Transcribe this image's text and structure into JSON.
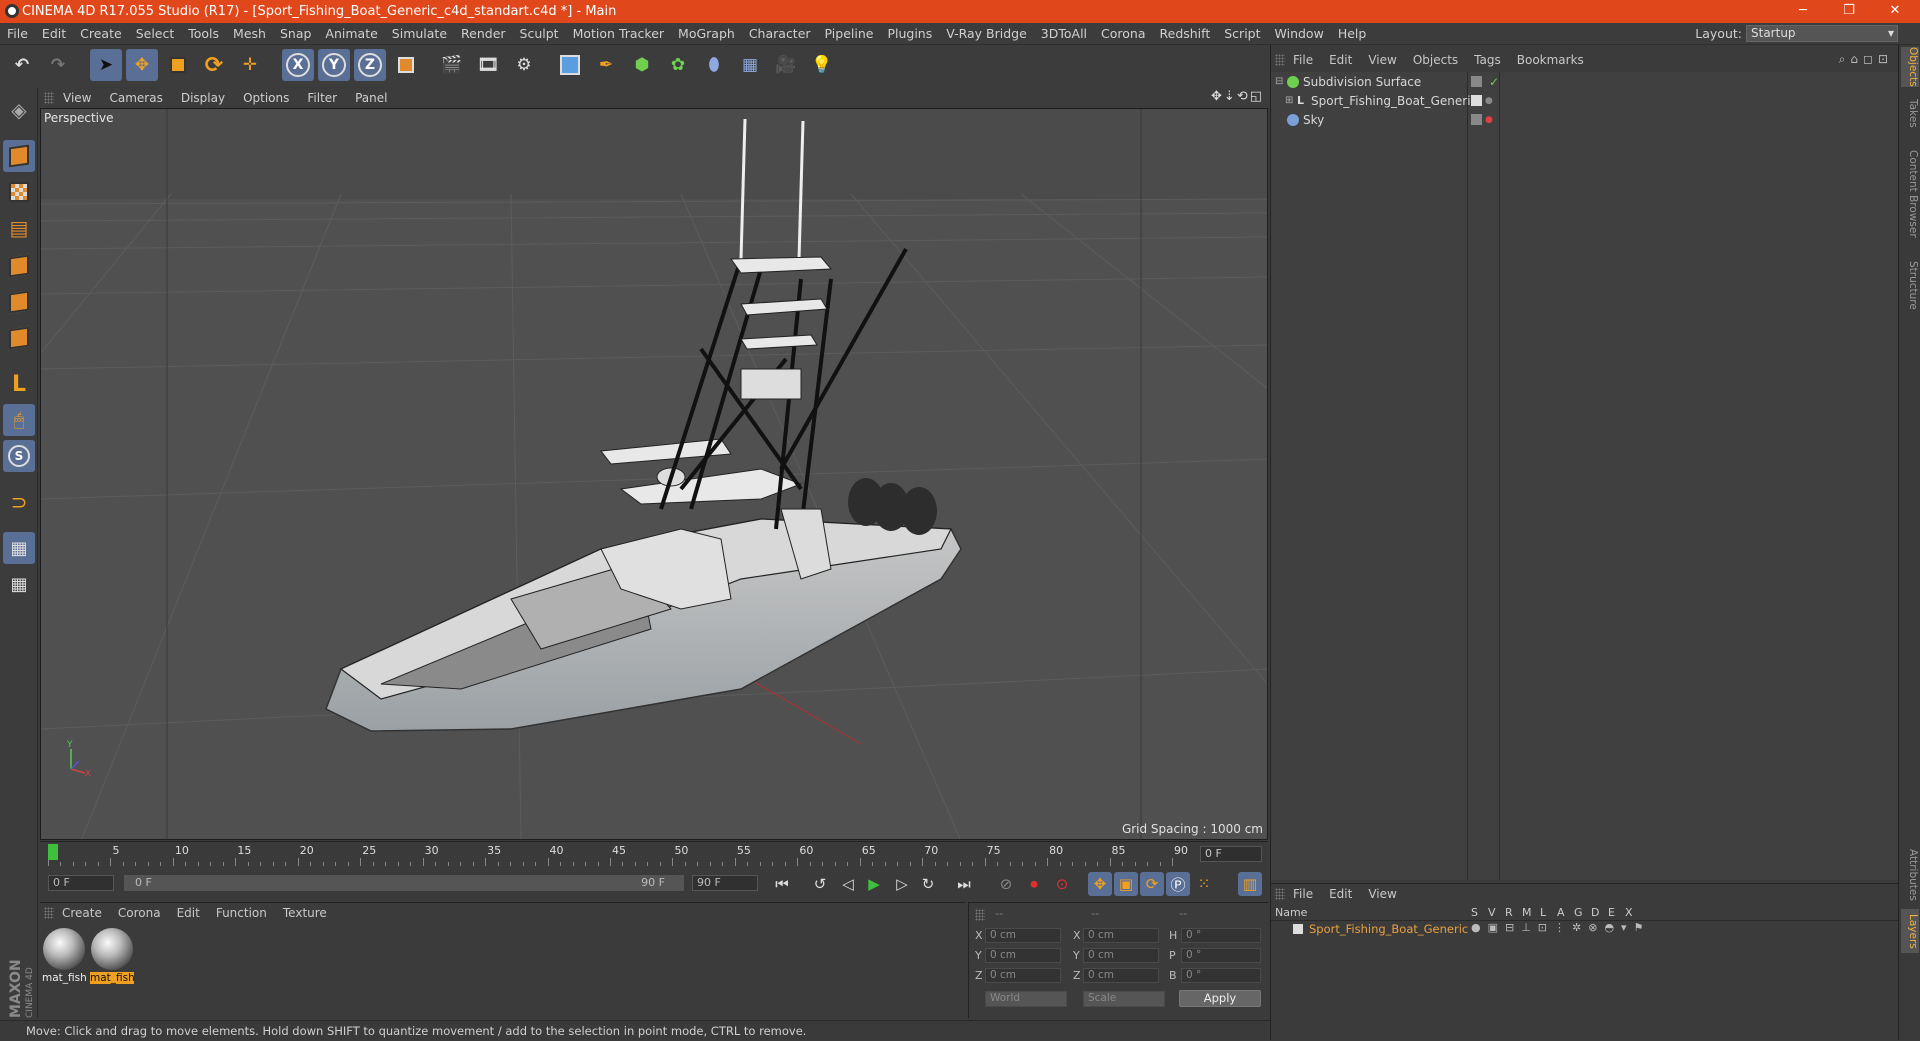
{
  "window": {
    "title": "CINEMA 4D R17.055 Studio (R17) - [Sport_Fishing_Boat_Generic_c4d_standart.c4d *] - Main",
    "minimize": "─",
    "restore": "❐",
    "close": "✕"
  },
  "menubar": {
    "items": [
      "File",
      "Edit",
      "Create",
      "Select",
      "Tools",
      "Mesh",
      "Snap",
      "Animate",
      "Simulate",
      "Render",
      "Sculpt",
      "Motion Tracker",
      "MoGraph",
      "Character",
      "Pipeline",
      "Plugins",
      "V-Ray Bridge",
      "3DToAll",
      "Corona",
      "Redshift",
      "Script",
      "Window",
      "Help"
    ],
    "layout_label": "Layout:",
    "layout_value": "Startup"
  },
  "toolbar": {
    "axis_x": "X",
    "axis_y": "Y",
    "axis_z": "Z"
  },
  "viewport": {
    "menu": [
      "View",
      "Cameras",
      "Display",
      "Options",
      "Filter",
      "Panel"
    ],
    "label": "Perspective",
    "grid_spacing": "Grid Spacing : 1000 cm"
  },
  "timeline": {
    "ticks": [
      "0",
      "5",
      "10",
      "15",
      "20",
      "25",
      "30",
      "35",
      "40",
      "45",
      "50",
      "55",
      "60",
      "65",
      "70",
      "75",
      "80",
      "85",
      "90"
    ],
    "current_frame": "0 F"
  },
  "transport": {
    "start_field": "0 F",
    "range_start": "0 F",
    "range_end": "90 F",
    "end_field": "90 F"
  },
  "materials": {
    "menu": [
      "Create",
      "Corona",
      "Edit",
      "Function",
      "Texture"
    ],
    "items": [
      {
        "label": "mat_fish",
        "selected": false
      },
      {
        "label": "mat_fish",
        "selected": true
      }
    ]
  },
  "coordinates": {
    "header": [
      "--",
      "--",
      "--"
    ],
    "rows": [
      {
        "a": "X",
        "v1": "0 cm",
        "b": "X",
        "v2": "0 cm",
        "c": "H",
        "v3": "0 °"
      },
      {
        "a": "Y",
        "v1": "0 cm",
        "b": "Y",
        "v2": "0 cm",
        "c": "P",
        "v3": "0 °"
      },
      {
        "a": "Z",
        "v1": "0 cm",
        "b": "Z",
        "v2": "0 cm",
        "c": "B",
        "v3": "0 °"
      }
    ],
    "mode1": "World",
    "mode2": "Scale",
    "apply": "Apply"
  },
  "objects": {
    "menu": [
      "File",
      "Edit",
      "View",
      "Objects",
      "Tags",
      "Bookmarks"
    ],
    "rows": [
      {
        "name": "Subdivision Surface",
        "icon_color": "#6fcf4f"
      },
      {
        "name": "Sport_Fishing_Boat_Generic",
        "icon_color": "#cccccc"
      },
      {
        "name": "Sky",
        "icon_color": "#7aa0d8"
      }
    ]
  },
  "layers": {
    "menu": [
      "File",
      "Edit",
      "View"
    ],
    "columns": [
      "Name",
      "S",
      "V",
      "R",
      "M",
      "L",
      "A",
      "G",
      "D",
      "E",
      "X"
    ],
    "row_name": "Sport_Fishing_Boat_Generic",
    "row_color": "#e8a040"
  },
  "side_tabs": [
    "Objects",
    "Takes",
    "Content Browser",
    "Structure"
  ],
  "side_tabs_bottom": [
    "Attributes",
    "Layers"
  ],
  "status": "Move: Click and drag to move elements. Hold down SHIFT to quantize movement / add to the selection in point mode, CTRL to remove.",
  "brand": {
    "line1": "MAXON",
    "line2": "CINEMA 4D"
  },
  "colors": {
    "accent": "#e0481c",
    "selected_tool": "#5a6f96",
    "highlight": "#f0a020"
  }
}
